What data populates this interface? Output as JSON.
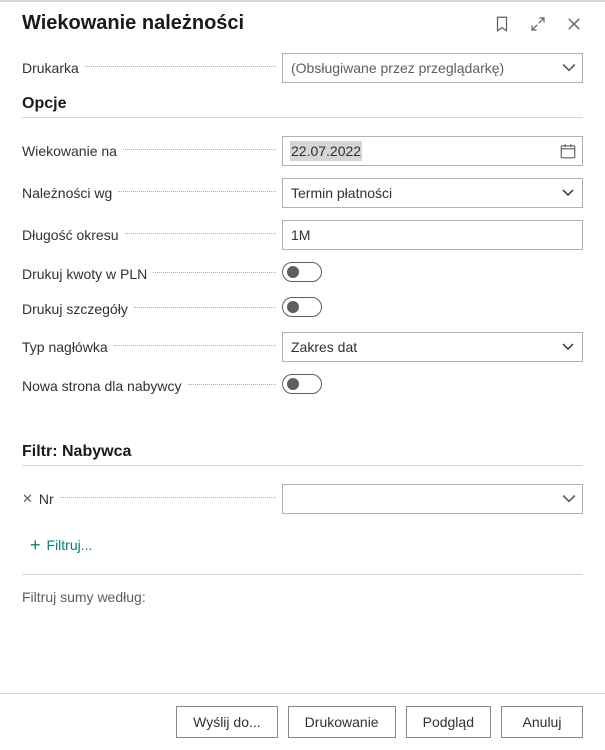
{
  "header": {
    "title": "Wiekowanie należności"
  },
  "printer": {
    "label": "Drukarka",
    "value": "(Obsługiwane przez przeglądarkę)"
  },
  "sections": {
    "options_title": "Opcje",
    "filter_title": "Filtr: Nabywca",
    "totals_filter_label": "Filtruj sumy według:"
  },
  "options": {
    "aging_on": {
      "label": "Wiekowanie na",
      "value": "22.07.2022"
    },
    "receivables_by": {
      "label": "Należności wg",
      "value": "Termin płatności"
    },
    "period_length": {
      "label": "Długość okresu",
      "value": "1M"
    },
    "print_in_pln": {
      "label": "Drukuj kwoty w PLN",
      "value": false
    },
    "print_details": {
      "label": "Drukuj szczegóły",
      "value": false
    },
    "header_type": {
      "label": "Typ nagłówka",
      "value": "Zakres dat"
    },
    "new_page_per_customer": {
      "label": "Nowa strona dla nabywcy",
      "value": false
    }
  },
  "filter": {
    "nr": {
      "label": "Nr",
      "value": ""
    },
    "add_filter_label": "Filtruj..."
  },
  "footer": {
    "send_to": "Wyślij do...",
    "print": "Drukowanie",
    "preview": "Podgląd",
    "cancel": "Anuluj"
  }
}
